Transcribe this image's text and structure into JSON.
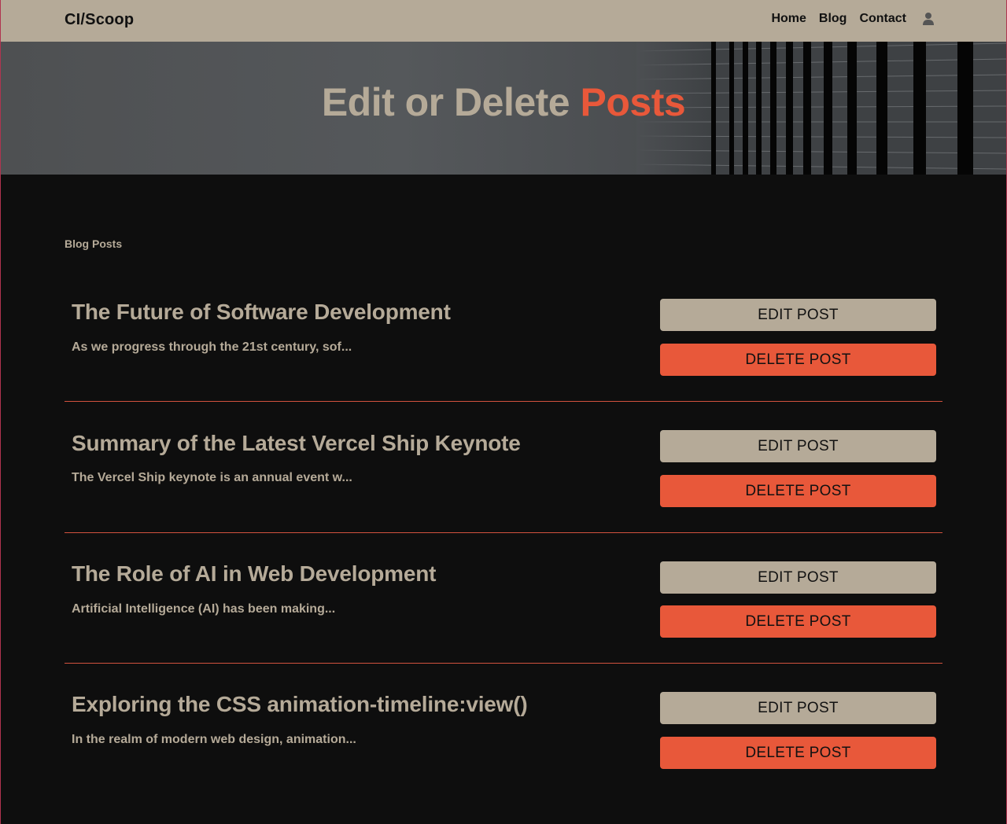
{
  "navbar": {
    "brand": "CI/Scoop",
    "links": [
      "Home",
      "Blog",
      "Contact"
    ],
    "user_icon": "user-icon"
  },
  "hero": {
    "title_main": "Edit or Delete ",
    "title_accent": "Posts"
  },
  "section_label": "Blog Posts",
  "posts": [
    {
      "title": "The Future of Software Development",
      "excerpt": "As we progress through the 21st century, sof...",
      "edit_label": "EDIT POST",
      "delete_label": "DELETE POST"
    },
    {
      "title": "Summary of the Latest Vercel Ship Keynote",
      "excerpt": "The Vercel Ship keynote is an annual event w...",
      "edit_label": "EDIT POST",
      "delete_label": "DELETE POST"
    },
    {
      "title": "The Role of AI in Web Development",
      "excerpt": "Artificial Intelligence (AI) has been making...",
      "edit_label": "EDIT POST",
      "delete_label": "DELETE POST"
    },
    {
      "title": "Exploring the CSS animation-timeline:view()",
      "excerpt": "In the realm of modern web design, animation...",
      "edit_label": "EDIT POST",
      "delete_label": "DELETE POST"
    }
  ],
  "colors": {
    "navbar_bg": "#b5aa98",
    "accent": "#e8583a",
    "page_bg": "#0e0e0e",
    "text_muted": "#b5aa98"
  }
}
